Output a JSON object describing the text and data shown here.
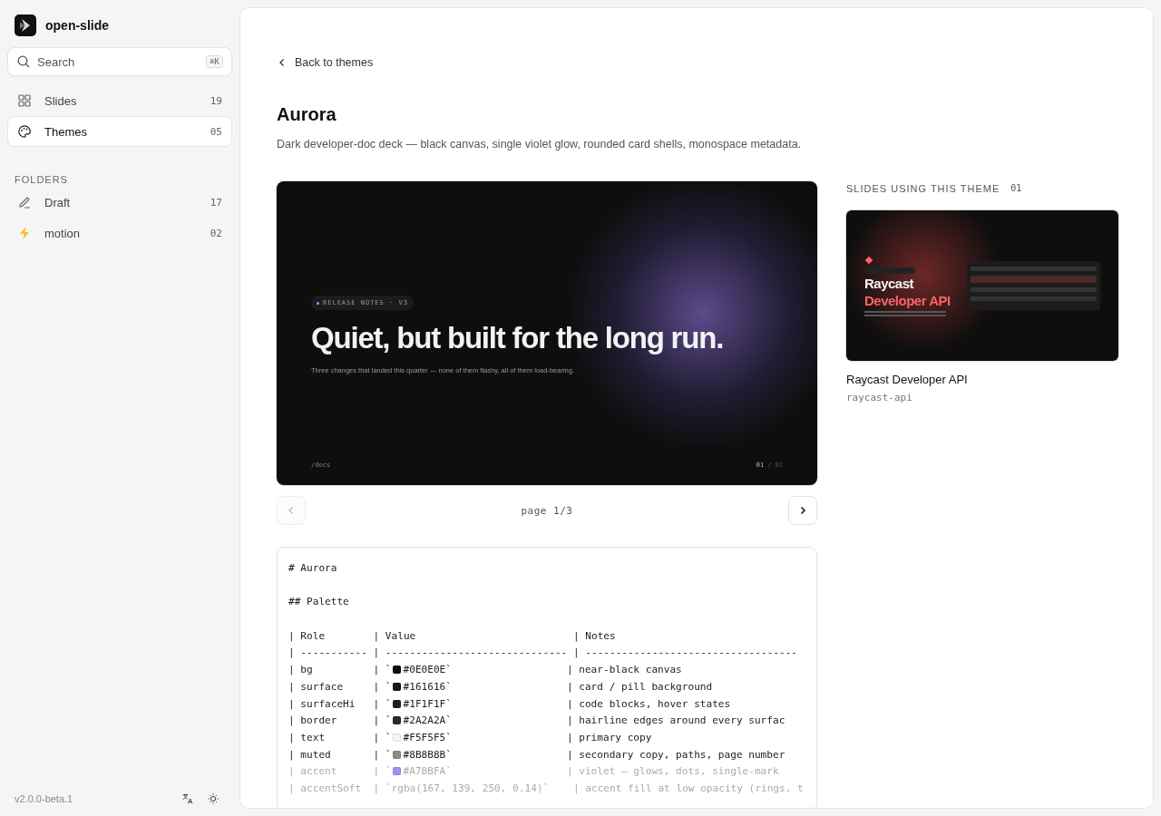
{
  "app": {
    "name": "open-slide"
  },
  "search": {
    "placeholder": "Search",
    "shortcut": "⌘K"
  },
  "nav": [
    {
      "label": "Slides",
      "count": "19",
      "selected": false
    },
    {
      "label": "Themes",
      "count": "05",
      "selected": true
    }
  ],
  "folders": {
    "title": "FOLDERS",
    "items": [
      {
        "label": "Draft",
        "count": "17"
      },
      {
        "label": "motion",
        "count": "02"
      }
    ]
  },
  "footer": {
    "version": "v2.0.0-beta.1"
  },
  "back_link": "Back to themes",
  "theme": {
    "title": "Aurora",
    "description": "Dark developer-doc deck — black canvas, single violet glow, rounded card shells, monospace metadata."
  },
  "preview": {
    "badge": "RELEASE NOTES · V3",
    "headline": "Quiet, but built for the long run.",
    "subtitle": "Three changes that landed this quarter — none of them flashy, all of them load-bearing.",
    "path": "/docs",
    "page_current": "01",
    "page_total": "/ 03"
  },
  "pager": {
    "label": "page 1/3",
    "prev": {
      "disabled": true
    },
    "next": {
      "disabled": false
    }
  },
  "usage": {
    "title": "SLIDES USING THIS THEME",
    "count": "01",
    "slides": [
      {
        "title": "Raycast Developer API",
        "slug": "raycast-api",
        "thumb_title": "Raycast",
        "thumb_accent": "Developer API"
      }
    ]
  },
  "source": {
    "lines": [
      {
        "kind": "text",
        "text": "# Aurora"
      },
      {
        "kind": "blank"
      },
      {
        "kind": "text",
        "text": "## Palette"
      },
      {
        "kind": "blank"
      },
      {
        "kind": "text",
        "text": "| Role        | Value                          | Notes"
      },
      {
        "kind": "text",
        "text": "| ----------- | ------------------------------ | -----------------------------------"
      },
      {
        "kind": "swatch",
        "before": "| bg          | `",
        "color": "#0e0e0e",
        "after": "#0E0E0E`                   | near-black canvas"
      },
      {
        "kind": "swatch",
        "before": "| surface     | `",
        "color": "#161616",
        "after": "#161616`                   | card / pill background"
      },
      {
        "kind": "swatch",
        "before": "| surfaceHi   | `",
        "color": "#1f1f1f",
        "after": "#1F1F1F`                   | code blocks, hover states"
      },
      {
        "kind": "swatch",
        "before": "| border      | `",
        "color": "#2a2a2a",
        "after": "#2A2A2A`                   | hairline edges around every surfac"
      },
      {
        "kind": "swatch",
        "before": "| text        | `",
        "color": "#f5f5f5",
        "after": "#F5F5F5`                   | primary copy"
      },
      {
        "kind": "swatch",
        "before": "| muted       | `",
        "color": "#8b8b8b",
        "after": "#8B8B8B`                   | secondary copy, paths, page number"
      },
      {
        "kind": "swatch",
        "dimmed": true,
        "before": "| accent      | `",
        "color": "#a78bfa",
        "after": "#A78BFA`                   | violet — glows, dots, single-mark"
      },
      {
        "kind": "text",
        "dimmed": true,
        "text": "| accentSoft  | `rgba(167, 139, 250, 0.14)`    | accent fill at low opacity (rings, t"
      }
    ]
  }
}
